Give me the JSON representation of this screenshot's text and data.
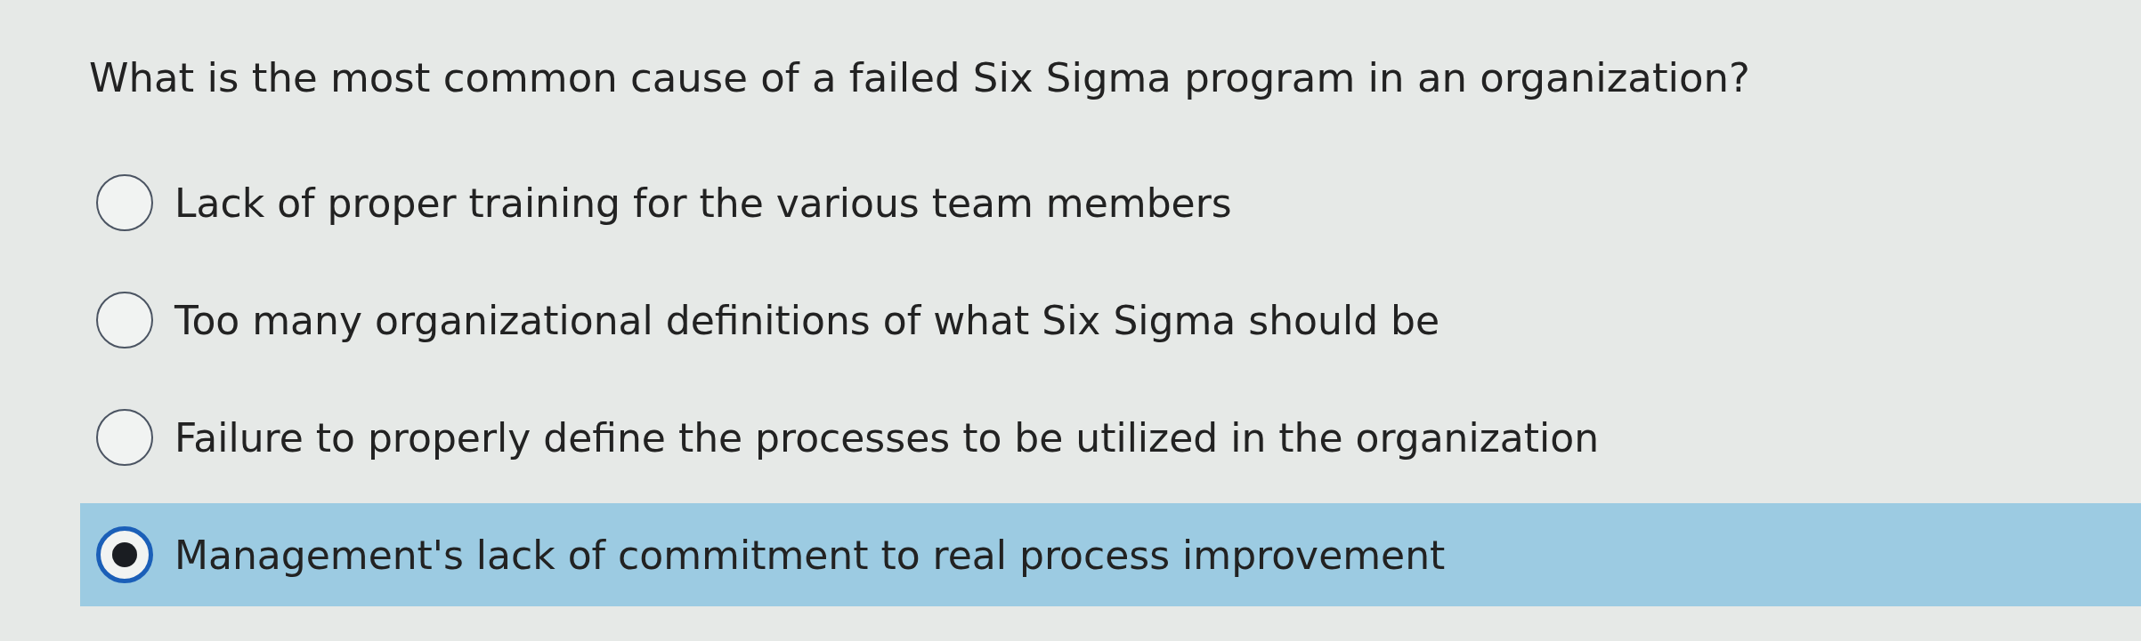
{
  "question": "What is the most common cause of a failed Six Sigma program in an organization?",
  "options": [
    {
      "label": "Lack of proper training for the various team members",
      "selected": false
    },
    {
      "label": "Too many organizational definitions of what Six Sigma should be",
      "selected": false
    },
    {
      "label": "Failure to properly define the processes to be utilized in the organization",
      "selected": false
    },
    {
      "label": "Management's lack of commitment to real process improvement",
      "selected": true
    }
  ]
}
